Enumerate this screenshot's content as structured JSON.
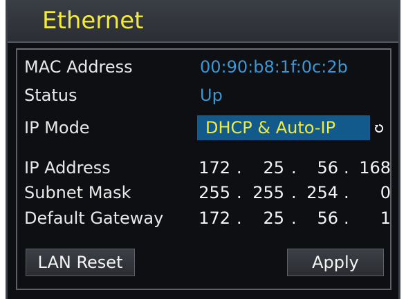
{
  "window": {
    "title": "Ethernet"
  },
  "fields": {
    "mac_label": "MAC Address",
    "mac_value": "00:90:b8:1f:0c:2b",
    "status_label": "Status",
    "status_value": "Up",
    "ip_mode_label": "IP Mode",
    "ip_mode_value": "DHCP & Auto-IP",
    "ip_address_label": "IP Address",
    "subnet_mask_label": "Subnet Mask",
    "default_gateway_label": "Default Gateway"
  },
  "ip_address": [
    "172",
    "25",
    "56",
    "168"
  ],
  "subnet_mask": [
    "255",
    "255",
    "254",
    "0"
  ],
  "default_gateway": [
    "172",
    "25",
    "56",
    "1"
  ],
  "buttons": {
    "lan_reset": "LAN Reset",
    "apply": "Apply"
  },
  "icons": {
    "ip_mode_cycle": "cycle-icon"
  },
  "colors": {
    "title": "#f2ea3c",
    "mac_value": "#3a97d4",
    "ip_mode_highlight": "#125a8c",
    "ip_mode_text": "#f2ea3c"
  }
}
